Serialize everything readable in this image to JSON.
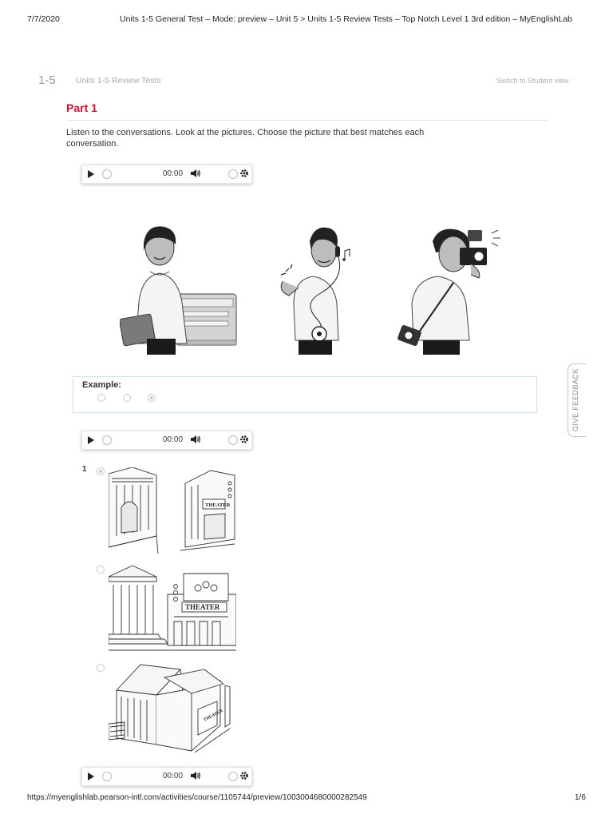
{
  "print_header": {
    "date": "7/7/2020",
    "title": "Units 1-5 General Test – Mode: preview – Unit 5 > Units 1-5 Review Tests – Top Notch Level 1 3rd edition – MyEnglishLab"
  },
  "unit": {
    "number": "1-5",
    "title": "Units 1-5 Review Tests",
    "switch_view": "Switch to Student view"
  },
  "part": {
    "title": "Part 1",
    "instructions": "Listen to the conversations. Look at the pictures. Choose the picture that best matches each conversation."
  },
  "audio_players": [
    {
      "time": "00:00"
    },
    {
      "time": "00:00"
    },
    {
      "time": "00:00"
    }
  ],
  "example": {
    "label": "Example:",
    "options": [
      {
        "selected": false
      },
      {
        "selected": false
      },
      {
        "selected": true
      }
    ]
  },
  "question1": {
    "number": "1",
    "options": [
      {
        "selected": true,
        "sign_text": "THEATER"
      },
      {
        "selected": false,
        "sign_text": "THEATER"
      },
      {
        "selected": false,
        "sign_text": "THEATER"
      }
    ]
  },
  "feedback_tab": {
    "label": "GIVE FEEDBACK"
  },
  "print_footer": {
    "url": "https://myenglishlab.pearson-intl.com/activities/course/1105744/preview/1003004680000282549",
    "page": "1/6"
  },
  "colors": {
    "accent": "#c8102e",
    "example_border": "#cfe0e4"
  }
}
